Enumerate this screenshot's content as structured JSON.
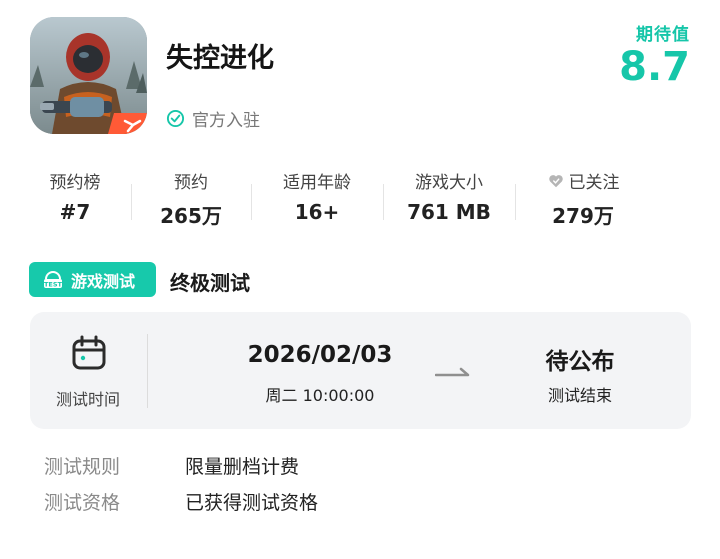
{
  "app": {
    "title": "失控进化",
    "official_label": "官方入驻",
    "icon_name": "game-app-icon"
  },
  "rating": {
    "label": "期待值",
    "value": "8.7"
  },
  "stats": [
    {
      "label": "预约榜",
      "value": "#7"
    },
    {
      "label": "预约",
      "value": "265万"
    },
    {
      "label": "适用年龄",
      "value": "16+"
    },
    {
      "label": "游戏大小",
      "value": "761 MB"
    },
    {
      "label": "已关注",
      "value": "279万",
      "icon": "heart-icon"
    }
  ],
  "test": {
    "badge_label": "游戏测试",
    "badge_icon": "test-icon",
    "name": "终极测试",
    "time_label": "测试时间",
    "start_date": "2026/02/03",
    "start_time": "周二  10:00:00",
    "end_status": "待公布",
    "end_label": "测试结束"
  },
  "info": [
    {
      "label": "测试规则",
      "value": "限量删档计费"
    },
    {
      "label": "测试资格",
      "value": "已获得测试资格"
    }
  ],
  "colors": {
    "accent": "#16c6a9",
    "card_bg": "#f3f4f6",
    "muted_text": "#8a8a8a"
  }
}
